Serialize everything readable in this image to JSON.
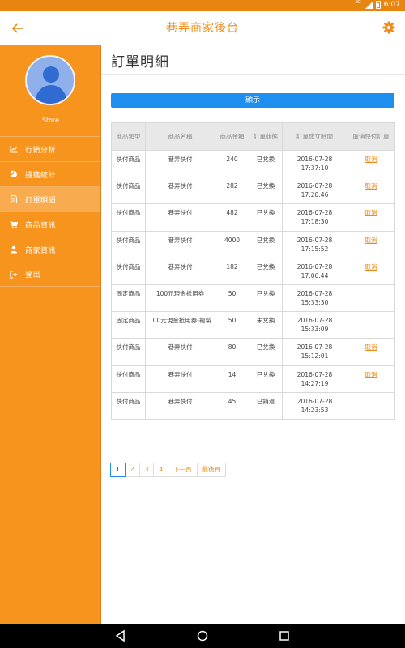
{
  "status_bar": {
    "network": "3G",
    "time": "6:07"
  },
  "app_bar": {
    "title": "巷弄商家後台"
  },
  "sidebar": {
    "store_name": "Store",
    "items": [
      {
        "label": "行銷分析",
        "icon": "line-chart-icon",
        "active": false
      },
      {
        "label": "擄獲統計",
        "icon": "pie-chart-icon",
        "active": false
      },
      {
        "label": "訂單明細",
        "icon": "document-icon",
        "active": true
      },
      {
        "label": "商品資訊",
        "icon": "cart-icon",
        "active": false
      },
      {
        "label": "商家資訊",
        "icon": "user-icon",
        "active": false
      },
      {
        "label": "登出",
        "icon": "logout-icon",
        "active": false
      }
    ]
  },
  "main": {
    "page_title": "訂單明細",
    "show_button": "顯示",
    "table": {
      "headers": [
        "商品類型",
        "商品名稱",
        "商品金額",
        "訂單狀態",
        "訂單成立時間",
        "取消快付訂單"
      ],
      "rows": [
        {
          "type": "快付商品",
          "name": "巷弄快付",
          "amount": "240",
          "status": "已兌換",
          "date": "2016-07-28",
          "time": "17:37:10",
          "cancel": "取消"
        },
        {
          "type": "快付商品",
          "name": "巷弄快付",
          "amount": "282",
          "status": "已兌換",
          "date": "2016-07-28",
          "time": "17:20:46",
          "cancel": "取消"
        },
        {
          "type": "快付商品",
          "name": "巷弄快付",
          "amount": "482",
          "status": "已兌換",
          "date": "2016-07-28",
          "time": "17:18:30",
          "cancel": "取消"
        },
        {
          "type": "快付商品",
          "name": "巷弄快付",
          "amount": "4000",
          "status": "已兌換",
          "date": "2016-07-28",
          "time": "17:15:52",
          "cancel": "取消"
        },
        {
          "type": "快付商品",
          "name": "巷弄快付",
          "amount": "182",
          "status": "已兌換",
          "date": "2016-07-28",
          "time": "17:06:44",
          "cancel": "取消"
        },
        {
          "type": "固定商品",
          "name": "100元現金抵用券",
          "amount": "50",
          "status": "已兌換",
          "date": "2016-07-28",
          "time": "15:33:30",
          "cancel": ""
        },
        {
          "type": "固定商品",
          "name": "100元現金抵用券-複製",
          "amount": "50",
          "status": "未兌換",
          "date": "2016-07-28",
          "time": "15:33:09",
          "cancel": ""
        },
        {
          "type": "快付商品",
          "name": "巷弄快付",
          "amount": "80",
          "status": "已兌換",
          "date": "2016-07-28",
          "time": "15:12:01",
          "cancel": "取消"
        },
        {
          "type": "快付商品",
          "name": "巷弄快付",
          "amount": "14",
          "status": "已兌換",
          "date": "2016-07-28",
          "time": "14:27:19",
          "cancel": "取消"
        },
        {
          "type": "快付商品",
          "name": "巷弄快付",
          "amount": "45",
          "status": "已銷退",
          "date": "2016-07-28",
          "time": "14:23:53",
          "cancel": ""
        }
      ]
    },
    "pagination": [
      "1",
      "2",
      "3",
      "4",
      "下一頁",
      "最後頁"
    ],
    "current_page": "1"
  },
  "colors": {
    "accent": "#f7941d",
    "primary_button": "#1e8fee",
    "link": "#f08a12"
  }
}
